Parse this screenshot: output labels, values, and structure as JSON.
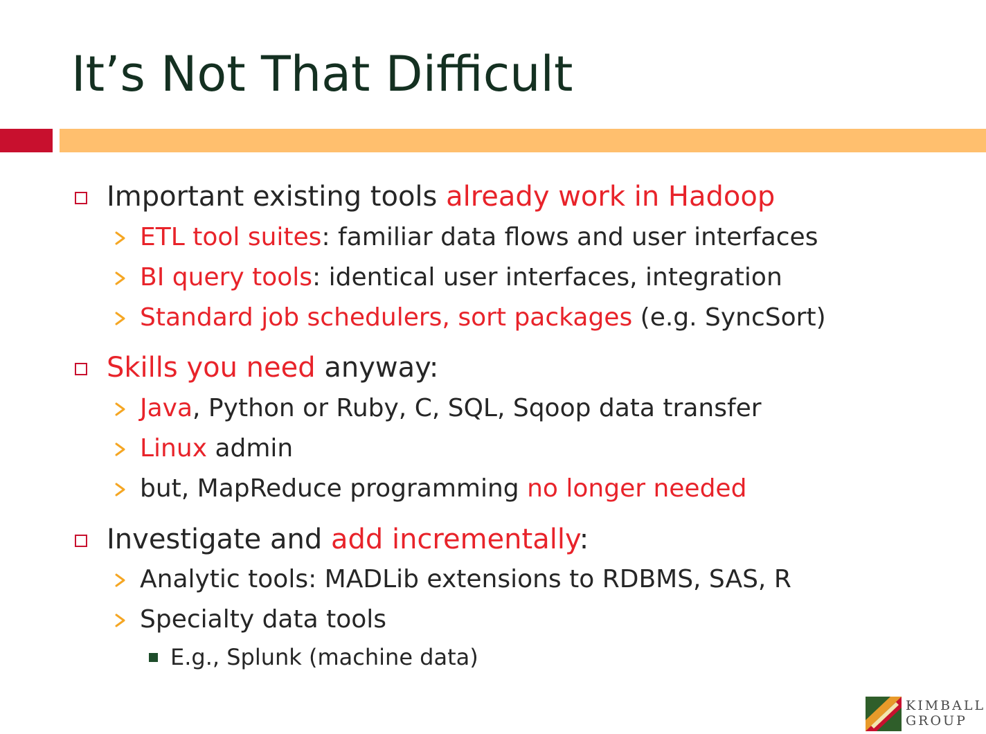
{
  "slide": {
    "title": "It’s Not That Difficult",
    "colors": {
      "title": "#143021",
      "accent_red": "#c8102e",
      "accent_orange": "#ffbf6e",
      "highlight": "#e8232a",
      "body_text": "#262626",
      "sub_bullet": "#f5a623",
      "square_bullet": "#1e4d2b"
    },
    "bullets": [
      {
        "segments": [
          {
            "text": "Important existing tools ",
            "highlight": false
          },
          {
            "text": "already work in Hadoop",
            "highlight": true
          }
        ],
        "children": [
          {
            "segments": [
              {
                "text": "ETL tool suites",
                "highlight": true
              },
              {
                "text": ": familiar data flows and user interfaces",
                "highlight": false
              }
            ]
          },
          {
            "segments": [
              {
                "text": "BI query tools",
                "highlight": true
              },
              {
                "text": ": identical user interfaces, integration",
                "highlight": false
              }
            ]
          },
          {
            "segments": [
              {
                "text": "Standard job schedulers, sort packages",
                "highlight": true
              },
              {
                "text": " (e.g. SyncSort)",
                "highlight": false
              }
            ]
          }
        ]
      },
      {
        "segments": [
          {
            "text": "Skills you need",
            "highlight": true
          },
          {
            "text": " anyway:",
            "highlight": false
          }
        ],
        "children": [
          {
            "segments": [
              {
                "text": "Java",
                "highlight": true
              },
              {
                "text": ", Python or Ruby, C, SQL, Sqoop data transfer",
                "highlight": false
              }
            ]
          },
          {
            "segments": [
              {
                "text": "Linux",
                "highlight": true
              },
              {
                "text": " admin",
                "highlight": false
              }
            ]
          },
          {
            "segments": [
              {
                "text": "but, MapReduce programming ",
                "highlight": false
              },
              {
                "text": "no longer needed",
                "highlight": true
              }
            ]
          }
        ]
      },
      {
        "segments": [
          {
            "text": "Investigate and ",
            "highlight": false
          },
          {
            "text": "add incrementally",
            "highlight": true
          },
          {
            "text": ":",
            "highlight": false
          }
        ],
        "children": [
          {
            "segments": [
              {
                "text": "Analytic tools: MADLib extensions to RDBMS, SAS, R",
                "highlight": false
              }
            ]
          },
          {
            "segments": [
              {
                "text": "Specialty data tools",
                "highlight": false
              }
            ],
            "children": [
              {
                "segments": [
                  {
                    "text": "E.g., Splunk (machine data)",
                    "highlight": false
                  }
                ]
              }
            ]
          }
        ]
      }
    ],
    "logo": {
      "line1": "KIMBALL",
      "line2": "GROUP"
    }
  }
}
